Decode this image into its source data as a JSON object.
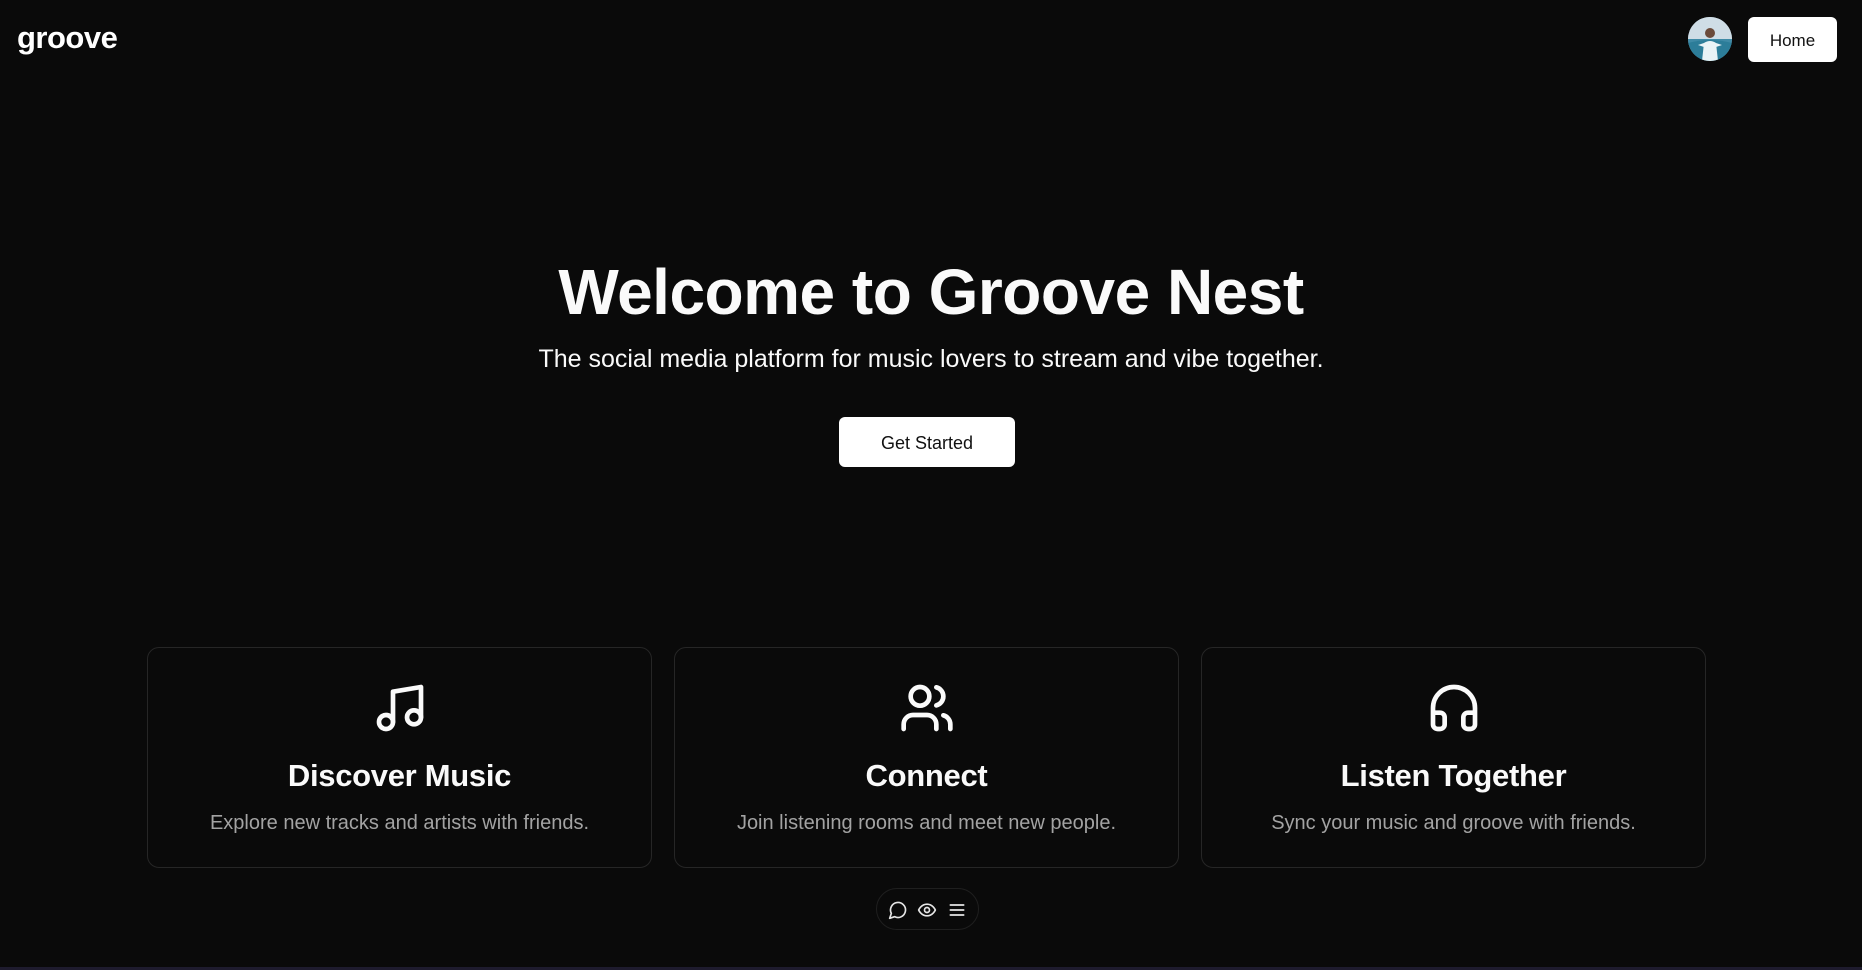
{
  "header": {
    "logo": "groove",
    "home_label": "Home"
  },
  "hero": {
    "title": "Welcome to Groove Nest",
    "subtitle": "The social media platform for music lovers to stream and vibe together.",
    "cta_label": "Get Started"
  },
  "features": [
    {
      "icon": "music-note-icon",
      "title": "Discover Music",
      "description": "Explore new tracks and artists with friends."
    },
    {
      "icon": "users-icon",
      "title": "Connect",
      "description": "Join listening rooms and meet new people."
    },
    {
      "icon": "headphones-icon",
      "title": "Listen Together",
      "description": "Sync your music and groove with friends."
    }
  ],
  "toolbar": {
    "icons": [
      "chat-bubble-icon",
      "eye-icon",
      "menu-icon"
    ]
  },
  "colors": {
    "background": "#0a0a0a",
    "foreground": "#fafafa",
    "muted_text": "#a3a3a3",
    "card_border": "#262626",
    "button_bg": "#ffffff",
    "button_text": "#111111"
  }
}
